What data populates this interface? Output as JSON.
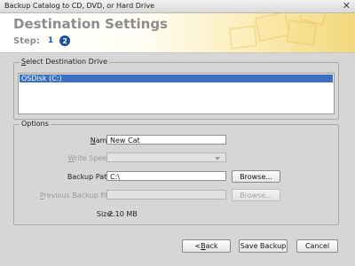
{
  "window": {
    "title": "Backup Catalog to CD, DVD, or Hard Drive",
    "close_glyph": "✕"
  },
  "header": {
    "title": "Destination Settings",
    "step_label": "Step:",
    "step_1": "1",
    "step_2": "2"
  },
  "drive_group": {
    "legend_underline": "S",
    "legend_rest": "elect Destination Drive",
    "drives": [
      "OSDisk (C:)"
    ],
    "selected_index": 0
  },
  "options": {
    "legend": "Options",
    "name_label_u": "N",
    "name_label_rest": "ame:",
    "name_value": "New Cat",
    "write_speed_label_u": "W",
    "write_speed_label_rest": "rite Speed:",
    "write_speed_value": "",
    "backup_path_label": "Backup Path:",
    "backup_path_value": "C:\\",
    "browse_label": "Browse...",
    "previous_label_u": "P",
    "previous_label_rest": "revious Backup file:",
    "previous_value": "",
    "browse2_label": "Browse...",
    "size_label": "Size:",
    "size_value": "2.10 MB"
  },
  "footer": {
    "back_label_u": "B",
    "back_prefix": "< ",
    "back_rest": "ack",
    "save_label": "Save Backup",
    "cancel_label": "Cancel"
  }
}
